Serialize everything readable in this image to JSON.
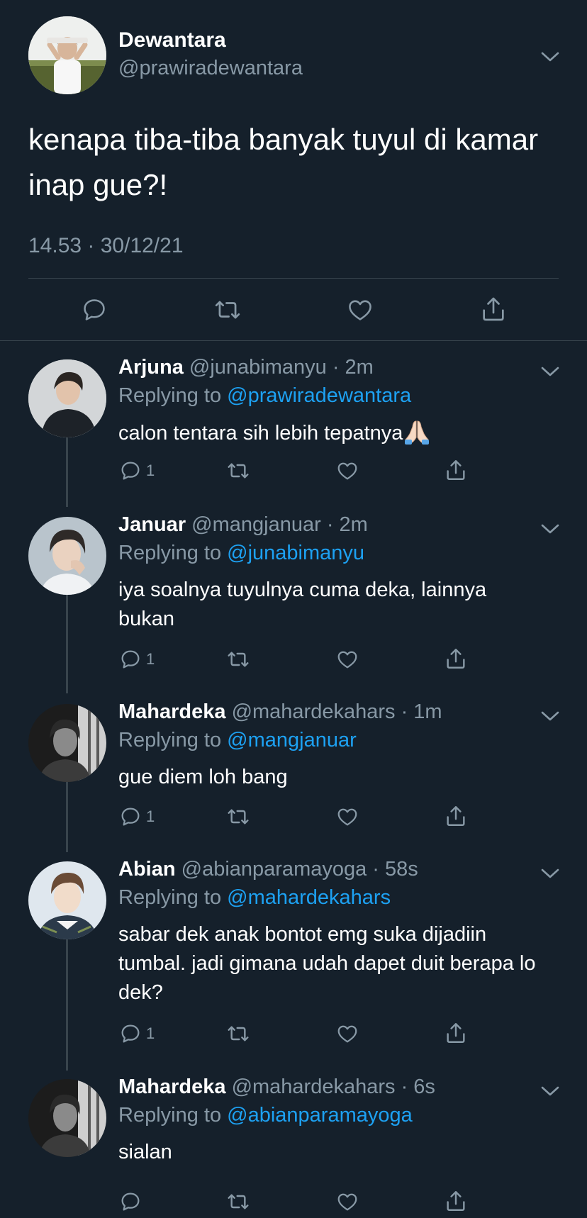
{
  "main_tweet": {
    "name": "Dewantara",
    "handle": "@prawiradewantara",
    "text": "kenapa tiba-tiba banyak tuyul di kamar inap gue?!",
    "timestamp": "14.53 · 30/12/21",
    "actions": [
      "reply-icon",
      "retweet-icon",
      "like-icon",
      "share-icon"
    ]
  },
  "replies": [
    {
      "name": "Arjuna",
      "meta": "@junabimanyu · 2m",
      "replying_prefix": "Replying to ",
      "replying_to": "@prawiradewantara",
      "text": "calon tentara sih lebih tepatnya",
      "emoji": "folded-hands",
      "reply_count": "1"
    },
    {
      "name": "Januar",
      "meta": "@mangjanuar · 2m",
      "replying_prefix": "Replying to ",
      "replying_to": "@junabimanyu",
      "text": "iya soalnya tuyulnya cuma deka, lainnya bukan",
      "reply_count": "1"
    },
    {
      "name": "Mahardeka",
      "meta": "@mahardekahars · 1m",
      "replying_prefix": "Replying to ",
      "replying_to": "@mangjanuar",
      "text": "gue diem loh bang",
      "reply_count": "1"
    },
    {
      "name": "Abian",
      "meta": "@abianparamayoga · 58s",
      "replying_prefix": "Replying to ",
      "replying_to": "@mahardekahars",
      "text": "sabar dek anak bontot emg suka dijadiin tumbal. jadi gimana udah dapet duit berapa lo dek?",
      "reply_count": "1"
    },
    {
      "name": "Mahardeka",
      "meta": "@mahardekahars · 6s",
      "replying_prefix": "Replying to ",
      "replying_to": "@abianparamayoga",
      "text": "sialan",
      "reply_count": ""
    }
  ],
  "colors": {
    "background": "#15202b",
    "secondary_text": "#8899a6",
    "link": "#1da1f2",
    "divider": "#38444d"
  }
}
